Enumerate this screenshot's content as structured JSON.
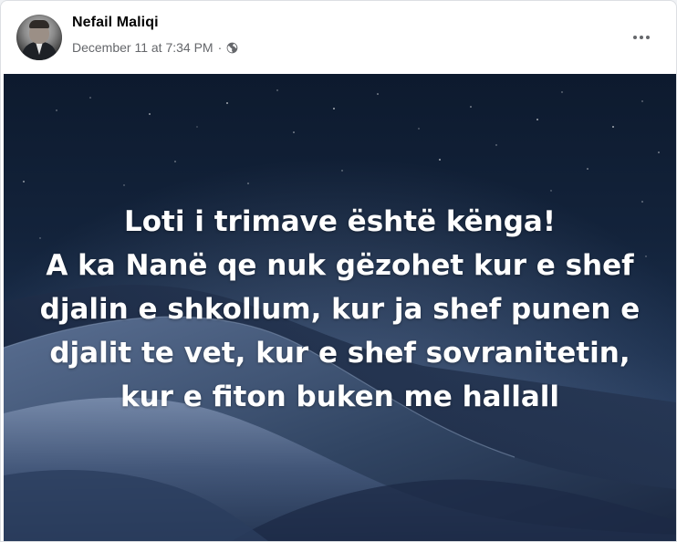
{
  "post": {
    "author": {
      "name": "Nefail Maliqi",
      "avatar_icon": "profile-photo"
    },
    "timestamp": "December 11 at 7:34 PM",
    "separator": "·",
    "audience_icon": "globe-icon",
    "more_icon": "more-options-icon",
    "content": {
      "lines": [
        "Loti i trimave është kënga!",
        "A ka Nanë qe nuk gëzohet kur e shef",
        "djalin e shkollum, kur ja shef punen e",
        "djalit te vet, kur e shef sovranitetin,",
        "kur e fiton buken me hallall"
      ],
      "background": "night-sky-desert-dunes",
      "text_color": "#ffffff"
    }
  },
  "colors": {
    "name": "#050505",
    "meta": "#65676b",
    "card": "#ffffff"
  }
}
